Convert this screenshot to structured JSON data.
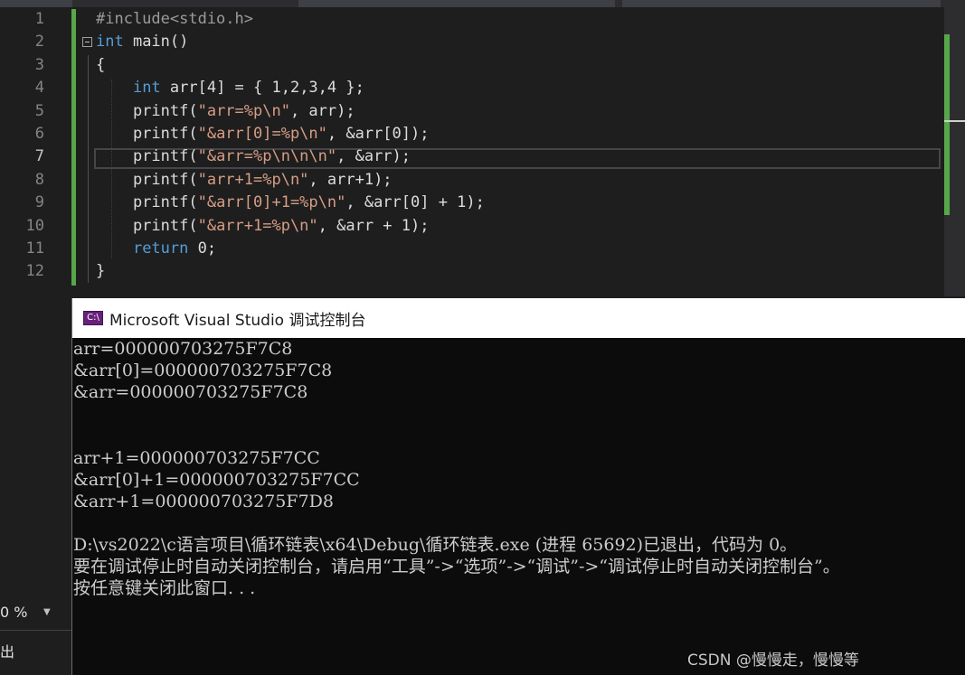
{
  "editor": {
    "line_numbers": [
      "1",
      "2",
      "3",
      "4",
      "5",
      "6",
      "7",
      "8",
      "9",
      "10",
      "11",
      "12"
    ],
    "active_line": "7",
    "lines": [
      [
        {
          "t": "#include<stdio.h>",
          "c": "pp"
        }
      ],
      [
        {
          "t": "int",
          "c": "kw"
        },
        {
          "t": " main()",
          "c": ""
        }
      ],
      [
        {
          "t": "{",
          "c": ""
        }
      ],
      [
        {
          "t": "    ",
          "c": ""
        },
        {
          "t": "int",
          "c": "kw"
        },
        {
          "t": " arr[4] = { 1,2,3,4 };",
          "c": ""
        }
      ],
      [
        {
          "t": "    printf(",
          "c": ""
        },
        {
          "t": "\"arr=%p\\n\"",
          "c": "str"
        },
        {
          "t": ", arr);",
          "c": ""
        }
      ],
      [
        {
          "t": "    printf(",
          "c": ""
        },
        {
          "t": "\"&arr[0]=%p\\n\"",
          "c": "str"
        },
        {
          "t": ", &arr[0]);",
          "c": ""
        }
      ],
      [
        {
          "t": "    printf(",
          "c": ""
        },
        {
          "t": "\"&arr=%p\\n\\n\\n\"",
          "c": "str"
        },
        {
          "t": ", &arr);",
          "c": ""
        }
      ],
      [
        {
          "t": "    printf(",
          "c": ""
        },
        {
          "t": "\"arr+1=%p\\n\"",
          "c": "str"
        },
        {
          "t": ", arr+1);",
          "c": ""
        }
      ],
      [
        {
          "t": "    printf(",
          "c": ""
        },
        {
          "t": "\"&arr[0]+1=%p\\n\"",
          "c": "str"
        },
        {
          "t": ", &arr[0] + 1);",
          "c": ""
        }
      ],
      [
        {
          "t": "    printf(",
          "c": ""
        },
        {
          "t": "\"&arr+1=%p\\n\"",
          "c": "str"
        },
        {
          "t": ", &arr + 1);",
          "c": ""
        }
      ],
      [
        {
          "t": "    ",
          "c": ""
        },
        {
          "t": "return",
          "c": "kw"
        },
        {
          "t": " 0;",
          "c": ""
        }
      ],
      [
        {
          "t": "}",
          "c": ""
        }
      ]
    ]
  },
  "status": {
    "zoom": "0 %",
    "bottom_label": "出"
  },
  "console": {
    "title": "Microsoft Visual Studio 调试控制台",
    "icon_text": "C:\\",
    "lines": [
      "arr=000000703275F7C8",
      "&arr[0]=000000703275F7C8",
      "&arr=000000703275F7C8",
      "",
      "",
      "arr+1=000000703275F7CC",
      "&arr[0]+1=000000703275F7CC",
      "&arr+1=000000703275F7D8",
      "",
      "D:\\vs2022\\c语言项目\\循环链表\\x64\\Debug\\循环链表.exe (进程 65692)已退出，代码为 0。",
      "要在调试停止时自动关闭控制台，请启用“工具”->“选项”->“调试”->“调试停止时自动关闭控制台”。",
      "按任意键关闭此窗口. . ."
    ]
  },
  "watermark": "CSDN @慢慢走，慢慢等",
  "colors": {
    "editor_bg": "#1e1e1e",
    "keyword": "#569cd6",
    "string": "#d69d85",
    "change_bar": "#57a64a",
    "console_bg": "#0c0c0c",
    "console_text": "#cccccc"
  }
}
